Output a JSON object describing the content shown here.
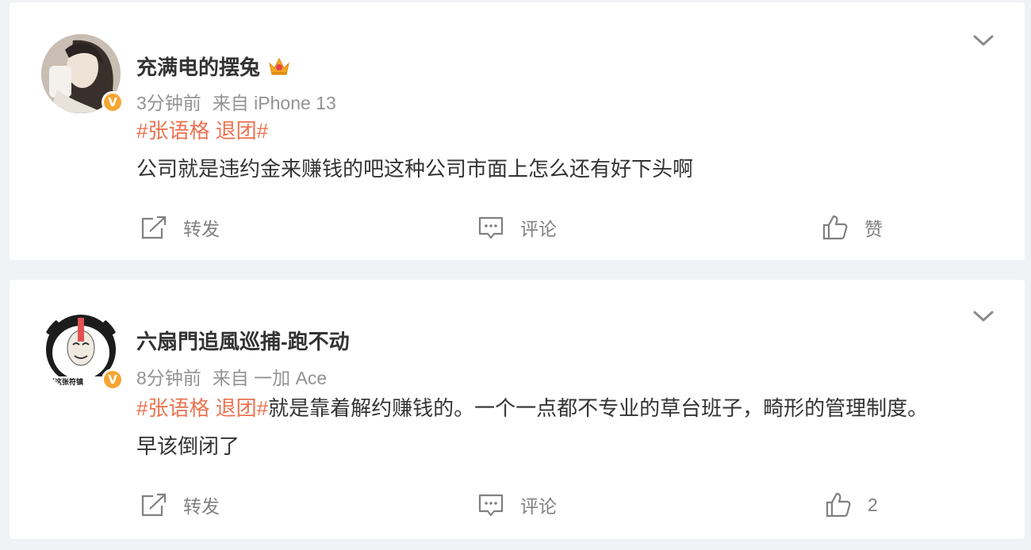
{
  "posts": [
    {
      "username": "充满电的摆兔",
      "time": "3分钟前",
      "source": "来自 iPhone 13",
      "topic": "#张语格 退团#",
      "body": "",
      "body_line1": "公司就是违约金来赚钱的吧这种公司市面上怎么还有好下头啊",
      "body_line2": "",
      "verified": "V",
      "actions": {
        "repost": "转发",
        "comment": "评论",
        "like": "赞"
      },
      "colors": {
        "topic": "#eb7350",
        "badge": "#f7a531",
        "crown": "#f5a623"
      },
      "icons": [
        "dropdown-chevron-icon",
        "crown-icon",
        "repost-icon",
        "comment-icon",
        "like-icon"
      ]
    },
    {
      "username": "六扇門追風巡捕-跑不动",
      "time": "8分钟前",
      "source": "来自 一加 Ace",
      "topic": "#张语格 退团#",
      "body_line1": "就是靠着解约赚钱的。一个一点都不专业的草台班子，畸形的管理制度。",
      "body_line2": "早该倒闭了",
      "verified": "V",
      "avatar_caption": "用这张符镇",
      "actions": {
        "repost": "转发",
        "comment": "评论",
        "like": "2"
      }
    }
  ]
}
